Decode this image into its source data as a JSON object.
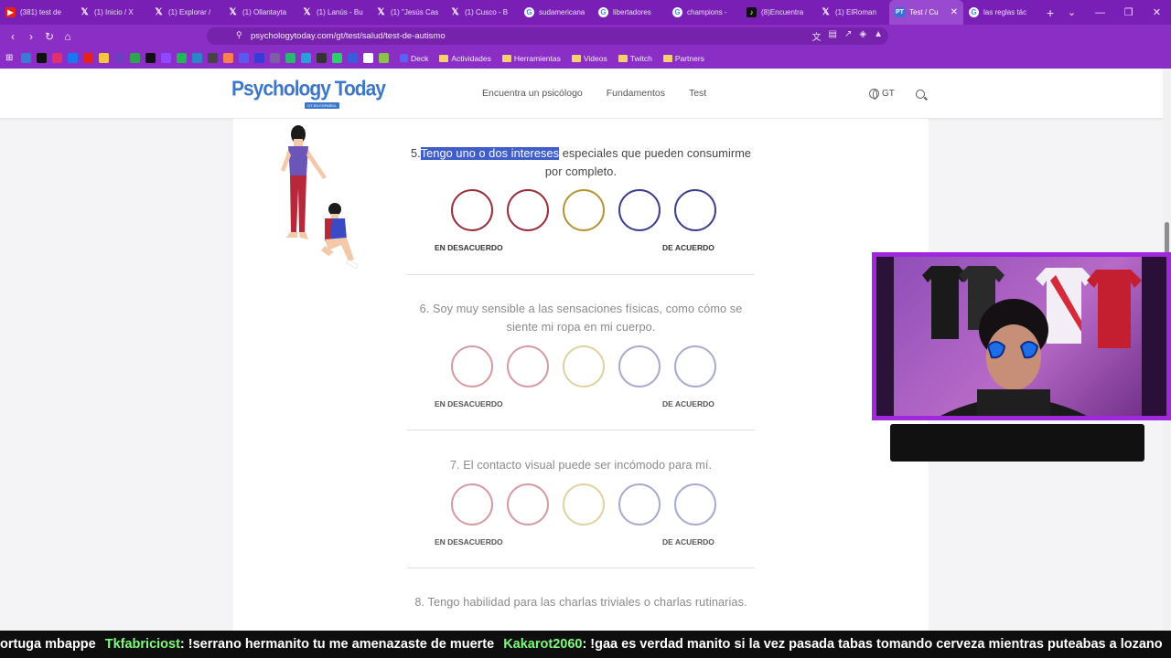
{
  "browser": {
    "tabs": [
      {
        "title": "(381) test de",
        "icon": "youtube-icon"
      },
      {
        "title": "(1) Inicio / X",
        "icon": "x-icon"
      },
      {
        "title": "(1) Explorar /",
        "icon": "x-icon"
      },
      {
        "title": "(1) Ollantayta",
        "icon": "x-icon"
      },
      {
        "title": "(1) Lanús - Bu",
        "icon": "x-icon"
      },
      {
        "title": "(1) \"Jesús Cas",
        "icon": "x-icon"
      },
      {
        "title": "(1) Cusco - B",
        "icon": "x-icon"
      },
      {
        "title": "sudamericana",
        "icon": "google-icon"
      },
      {
        "title": "libertadores",
        "icon": "google-icon"
      },
      {
        "title": "champions -",
        "icon": "google-icon"
      },
      {
        "title": "(8)Encuentra",
        "icon": "tiktok-icon"
      },
      {
        "title": "(1) ElRoman",
        "icon": "x-icon"
      },
      {
        "title": "Test / Cu",
        "icon": "pt-icon",
        "active": true
      },
      {
        "title": "las reglas tác",
        "icon": "google-icon"
      }
    ],
    "url": "psychologytoday.com/gt/test/salud/test-de-autismo",
    "bookmarks": {
      "folders": [
        "Deck",
        "Actividades",
        "Herramientas",
        "Videos",
        "Twitch",
        "Partners"
      ]
    }
  },
  "site": {
    "logo": "Psychology Today",
    "logo_sub": "GT EN ESPAÑOL",
    "nav": [
      "Encuentra un psicólogo",
      "Fundamentos",
      "Test"
    ],
    "region": "GT"
  },
  "questions": [
    {
      "number": "5.",
      "highlight": "Tengo uno o dos intereses",
      "rest": " especiales que pueden consumirme por completo.",
      "left_label": "EN DESACUERDO",
      "right_label": "DE ACUERDO",
      "active": true
    },
    {
      "number": "6.",
      "highlight": "",
      "rest": " Soy muy sensible a las sensaciones físicas, como cómo se siente mi ropa en mi cuerpo.",
      "left_label": "EN DESACUERDO",
      "right_label": "DE ACUERDO",
      "active": false
    },
    {
      "number": "7.",
      "highlight": "",
      "rest": " El contacto visual puede ser incómodo para mí.",
      "left_label": "EN DESACUERDO",
      "right_label": "DE ACUERDO",
      "active": false
    },
    {
      "number": "8.",
      "highlight": "",
      "rest": " Tengo habilidad para las charlas triviales o charlas rutinarias.",
      "active": false
    }
  ],
  "colors": {
    "circle_active": [
      "#9a2d3c",
      "#9a2d3c",
      "#b39536",
      "#3d3f8c",
      "#3d3f8c"
    ],
    "circle_faded": [
      "#d59aa2",
      "#d59aa2",
      "#e0d2a0",
      "#a9aacf",
      "#a9aacf"
    ],
    "browser_purple": "#8a2ec6",
    "brand_blue": "#3c78c9"
  },
  "ticker": {
    "segments": [
      {
        "type": "msg",
        "text": "ortuga mbappe"
      },
      {
        "type": "user",
        "text": "Tkfabriciost"
      },
      {
        "type": "msg",
        "text": ": !serrano hermanito tu me amenazaste de muerte"
      },
      {
        "type": "user",
        "text": "Kakarot2060"
      },
      {
        "type": "msg",
        "text": ": !gaa es verdad manito si la vez pasada tabas tomando cerveza mientras puteabas a lozano"
      }
    ]
  }
}
